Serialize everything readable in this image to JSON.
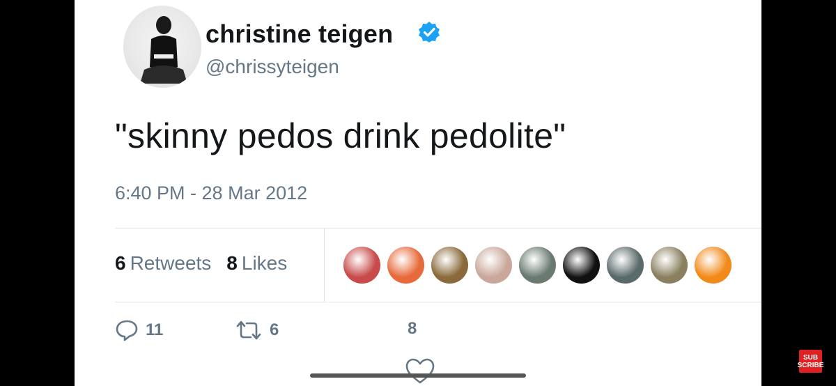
{
  "profile": {
    "name": "christine teigen",
    "handle": "@chrissyteigen"
  },
  "tweet": {
    "text": "\"skinny pedos drink pedolite\"",
    "timestamp": "6:40 PM - 28 Mar 2012"
  },
  "stats": {
    "retweets_count": "6",
    "retweets_label": "Retweets",
    "likes_count": "8",
    "likes_label": "Likes"
  },
  "likers": [
    {
      "icon": "liker-avatar-1",
      "color": "#c84a4a"
    },
    {
      "icon": "liker-avatar-2",
      "color": "#e66a3a"
    },
    {
      "icon": "liker-avatar-3",
      "color": "#8a6a3a"
    },
    {
      "icon": "liker-avatar-4",
      "color": "#c9a79a"
    },
    {
      "icon": "liker-avatar-5",
      "color": "#6a7a70"
    },
    {
      "icon": "liker-avatar-6",
      "color": "#111111"
    },
    {
      "icon": "liker-avatar-7",
      "color": "#5a6a6a"
    },
    {
      "icon": "liker-avatar-8",
      "color": "#8a8060"
    },
    {
      "icon": "liker-avatar-9",
      "color": "#f28a1a"
    }
  ],
  "actions": {
    "reply_count": "11",
    "retweet_count": "6",
    "like_count": "8"
  },
  "subscribe_label": "SUB SCRIBE",
  "colors": {
    "verified_blue": "#1da1f2",
    "text_primary": "#14171a",
    "text_secondary": "#657786",
    "divider": "#e1e8ed"
  }
}
